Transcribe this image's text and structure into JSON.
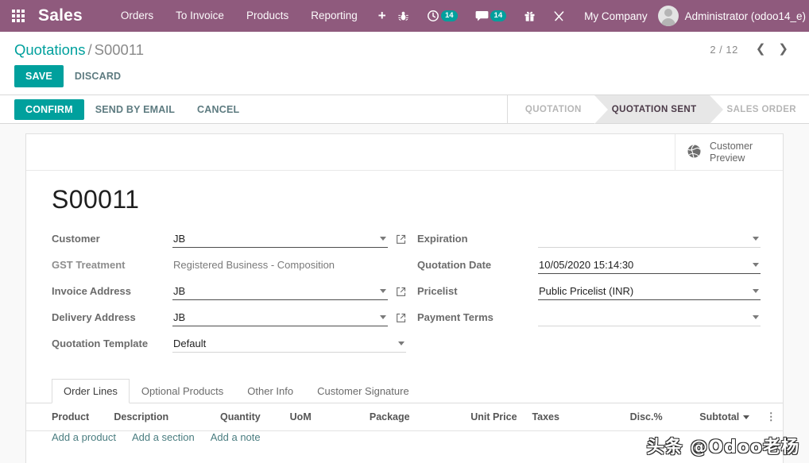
{
  "navbar": {
    "apps_icon": "grid-apps-icon",
    "brand": "Sales",
    "menu": [
      {
        "label": "Orders"
      },
      {
        "label": "To Invoice"
      },
      {
        "label": "Products"
      },
      {
        "label": "Reporting"
      }
    ],
    "new_label": "+",
    "systray": [
      {
        "name": "bug-icon",
        "badge": ""
      },
      {
        "name": "activities-clock-icon",
        "badge": "14"
      },
      {
        "name": "messages-icon",
        "badge": "14"
      },
      {
        "name": "gift-icon",
        "badge": ""
      },
      {
        "name": "tools-icon",
        "badge": ""
      }
    ],
    "company": "My Company",
    "user": "Administrator (odoo14_e)",
    "accent_color": "#8f5a7d",
    "badge_color": "#00a09d"
  },
  "control_panel": {
    "breadcrumb": {
      "parent": "Quotations",
      "separator": "/",
      "current": "S00011"
    },
    "save_label": "SAVE",
    "discard_label": "DISCARD",
    "pager": {
      "value": "2 / 12",
      "prev_icon": "chevron-left-icon",
      "next_icon": "chevron-right-icon"
    }
  },
  "action_bar": {
    "buttons": [
      {
        "label": "CONFIRM",
        "style": "primary"
      },
      {
        "label": "SEND BY EMAIL",
        "style": "link"
      },
      {
        "label": "CANCEL",
        "style": "link"
      }
    ],
    "statusbar": [
      {
        "label": "QUOTATION",
        "active": false
      },
      {
        "label": "QUOTATION SENT",
        "active": true
      },
      {
        "label": "SALES ORDER",
        "active": false
      }
    ]
  },
  "sheet": {
    "stat_button": {
      "icon": "globe-icon",
      "line1": "Customer",
      "line2": "Preview"
    },
    "title": "S00011",
    "left_fields": [
      {
        "label": "Customer",
        "value": "JB",
        "type": "many2one",
        "external_link": true,
        "filled": true
      },
      {
        "label": "GST Treatment",
        "value": "Registered Business - Composition",
        "type": "readonly",
        "external_link": false,
        "filled": false
      },
      {
        "label": "Invoice Address",
        "value": "JB",
        "type": "many2one",
        "external_link": true,
        "filled": true
      },
      {
        "label": "Delivery Address",
        "value": "JB",
        "type": "many2one",
        "external_link": true,
        "filled": true
      },
      {
        "label": "Quotation Template",
        "value": "Default",
        "type": "many2one",
        "external_link": false,
        "filled": false
      }
    ],
    "right_fields": [
      {
        "label": "Expiration",
        "value": "",
        "type": "date",
        "external_link": false,
        "filled": false
      },
      {
        "label": "Quotation Date",
        "value": "10/05/2020 15:14:30",
        "type": "datetime",
        "external_link": false,
        "filled": true
      },
      {
        "label": "Pricelist",
        "value": "Public Pricelist (INR)",
        "type": "many2one",
        "external_link": false,
        "filled": true
      },
      {
        "label": "Payment Terms",
        "value": "",
        "type": "many2one",
        "external_link": false,
        "filled": false
      }
    ]
  },
  "notebook": {
    "tabs": [
      {
        "label": "Order Lines",
        "active": true
      },
      {
        "label": "Optional Products",
        "active": false
      },
      {
        "label": "Other Info",
        "active": false
      },
      {
        "label": "Customer Signature",
        "active": false
      }
    ],
    "columns": [
      {
        "label": "Product",
        "align": "left"
      },
      {
        "label": "Description",
        "align": "left"
      },
      {
        "label": "Quantity",
        "align": "left"
      },
      {
        "label": "UoM",
        "align": "left"
      },
      {
        "label": "Package",
        "align": "left"
      },
      {
        "label": "Unit Price",
        "align": "left"
      },
      {
        "label": "Taxes",
        "align": "left"
      },
      {
        "label": "Disc.%",
        "align": "left"
      },
      {
        "label": "Subtotal",
        "align": "left",
        "sortable": true
      }
    ],
    "optional_columns_icon": "vertical-dots-icon",
    "rows": [],
    "add_links": [
      {
        "label": "Add a product"
      },
      {
        "label": "Add a section"
      },
      {
        "label": "Add a note"
      }
    ]
  },
  "watermark": "头条 @Odoo老杨"
}
